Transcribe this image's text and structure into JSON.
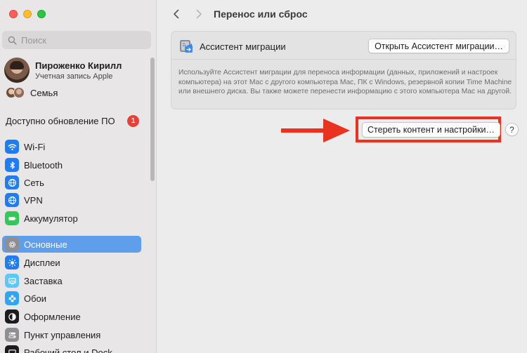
{
  "sidebar": {
    "search": {
      "placeholder": "Поиск"
    },
    "profile": {
      "name": "Пироженко Кирилл",
      "subtitle": "Учетная запись Apple"
    },
    "family": {
      "label": "Семья"
    },
    "update": {
      "label": "Доступно обновление ПО",
      "badge": "1"
    },
    "items": [
      {
        "label": "Wi-Fi",
        "icon": "wifi-icon",
        "color": "#1f7cf2"
      },
      {
        "label": "Bluetooth",
        "icon": "bluetooth-icon",
        "color": "#1f7cf2"
      },
      {
        "label": "Сеть",
        "icon": "globe-icon",
        "color": "#1f7cf2"
      },
      {
        "label": "VPN",
        "icon": "vpn-globe-icon",
        "color": "#1f7cf2"
      },
      {
        "label": "Аккумулятор",
        "icon": "battery-icon",
        "color": "#34c759"
      },
      {
        "label": "Основные",
        "icon": "gear-icon",
        "color": "#8e8e93",
        "selected": true
      },
      {
        "label": "Дисплеи",
        "icon": "sun-icon",
        "color": "#1f7cf2"
      },
      {
        "label": "Заставка",
        "icon": "screensaver-icon",
        "color": "#5ac8fa"
      },
      {
        "label": "Обои",
        "icon": "wallpaper-flower-icon",
        "color": "#2ea6f5"
      },
      {
        "label": "Оформление",
        "icon": "appearance-icon",
        "color": "#1c1c1e"
      },
      {
        "label": "Пункт управления",
        "icon": "control-center-icon",
        "color": "#8e8e93"
      },
      {
        "label": "Рабочий стол и Dock",
        "icon": "dock-icon",
        "color": "#1c1c1e"
      }
    ]
  },
  "main": {
    "title": "Перенос или сброс",
    "migration": {
      "title": "Ассистент миграции",
      "button": "Открыть Ассистент миграции…",
      "description": "Используйте Ассистент миграции для переноса информации (данных, приложений и настроек компьютера) на этот Mac с другого компьютера Mac, ПК с Windows, резервной копии Time Machine или внешнего диска. Вы также можете перенести информацию с этого компьютера Mac на другой."
    },
    "erase_button": "Стереть контент и настройки…",
    "help_button": "?"
  },
  "colors": {
    "accent": "#5e9eea",
    "highlight": "#e9321f",
    "badge": "#ea3f36"
  }
}
